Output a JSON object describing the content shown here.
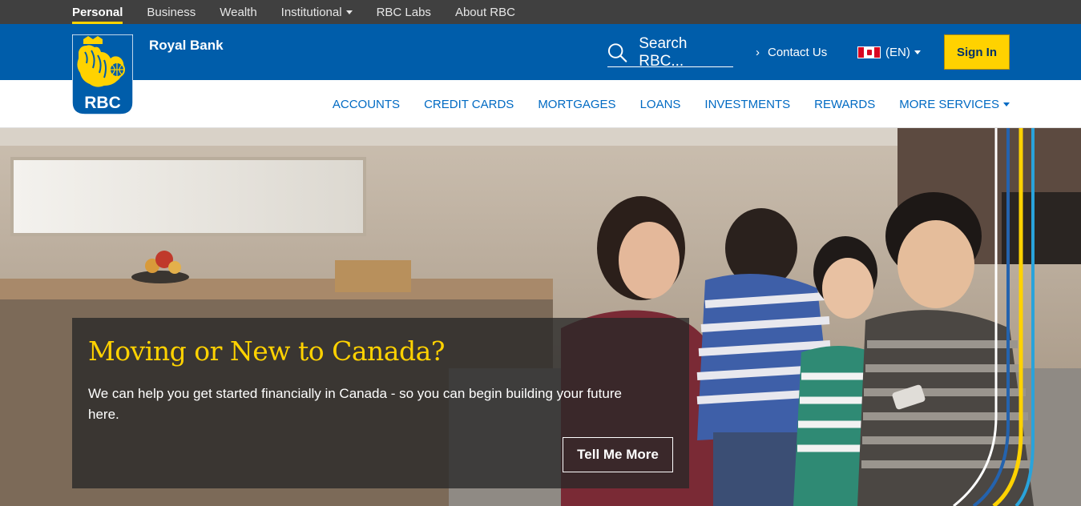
{
  "topnav": {
    "items": [
      {
        "label": "Personal"
      },
      {
        "label": "Business"
      },
      {
        "label": "Wealth"
      },
      {
        "label": "Institutional"
      },
      {
        "label": "RBC Labs"
      },
      {
        "label": "About RBC"
      }
    ]
  },
  "header": {
    "brand": "Royal Bank",
    "logo_text": "RBC",
    "search_placeholder": "Search RBC...",
    "contact": "Contact Us",
    "language": "(EN)",
    "signin": "Sign In"
  },
  "mainnav": {
    "items": [
      {
        "label": "ACCOUNTS"
      },
      {
        "label": "CREDIT CARDS"
      },
      {
        "label": "MORTGAGES"
      },
      {
        "label": "LOANS"
      },
      {
        "label": "INVESTMENTS"
      },
      {
        "label": "REWARDS"
      },
      {
        "label": "MORE SERVICES"
      }
    ]
  },
  "hero": {
    "title": "Moving or New to Canada?",
    "body": "We can help you get started financially in Canada - so you can begin building your future here.",
    "cta": "Tell Me More"
  },
  "colors": {
    "brand_blue": "#005daa",
    "brand_yellow": "#ffd200",
    "topbar": "#404040",
    "nav_link": "#006ac3"
  },
  "icons": [
    "search-icon",
    "chevron-right-icon",
    "canada-flag-icon",
    "caret-down-icon",
    "rbc-lion-logo"
  ]
}
